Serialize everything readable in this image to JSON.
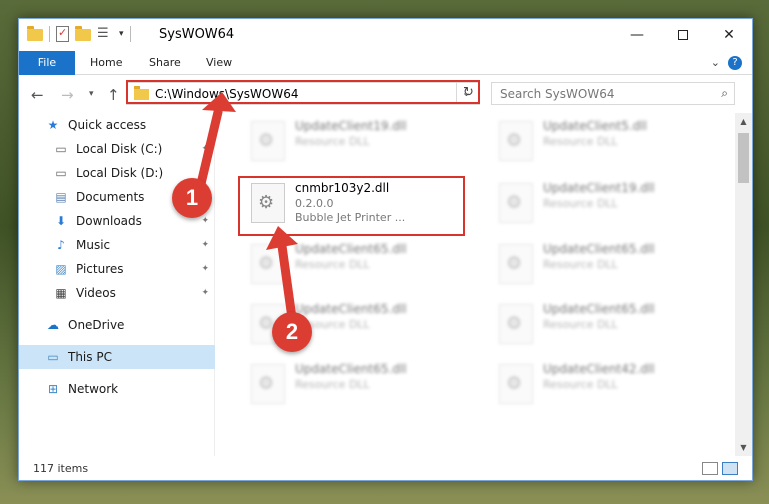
{
  "window": {
    "title": "SysWOW64"
  },
  "ribbon": {
    "tabs": [
      "File",
      "Home",
      "Share",
      "View"
    ]
  },
  "address": {
    "path": "C:\\Windows\\SysWOW64"
  },
  "search": {
    "placeholder": "Search SysWOW64"
  },
  "nav": {
    "items": [
      {
        "label": "Quick access",
        "icon": "star-icon",
        "pinned": false
      },
      {
        "label": "Local Disk (C:)",
        "icon": "drive-icon",
        "pinned": true
      },
      {
        "label": "Local Disk (D:)",
        "icon": "drive-icon",
        "pinned": true
      },
      {
        "label": "Documents",
        "icon": "documents-icon",
        "pinned": true
      },
      {
        "label": "Downloads",
        "icon": "downloads-icon",
        "pinned": true
      },
      {
        "label": "Music",
        "icon": "music-icon",
        "pinned": true
      },
      {
        "label": "Pictures",
        "icon": "pictures-icon",
        "pinned": true
      },
      {
        "label": "Videos",
        "icon": "videos-icon",
        "pinned": true
      },
      {
        "label": "OneDrive",
        "icon": "cloud-icon",
        "pinned": false
      },
      {
        "label": "This PC",
        "icon": "computer-icon",
        "pinned": false,
        "selected": true
      },
      {
        "label": "Network",
        "icon": "network-icon",
        "pinned": false
      }
    ]
  },
  "files": {
    "highlighted": {
      "name": "cnmbr103y2.dll",
      "version": "0.2.0.0",
      "description": "Bubble Jet Printer ..."
    },
    "blurred": [
      {
        "name": "UpdateClient19.dll",
        "type": "Resource DLL"
      },
      {
        "name": "UpdateClient5.dll",
        "type": "Resource DLL"
      },
      {
        "name": "UpdateClient19.dll",
        "type": "Resource DLL"
      },
      {
        "name": "UpdateClient65.dll",
        "type": "Resource DLL"
      },
      {
        "name": "UpdateClient65.dll",
        "type": "Resource DLL"
      },
      {
        "name": "UpdateClient65.dll",
        "type": "Resource DLL"
      },
      {
        "name": "UpdateClient65.dll",
        "type": "Resource DLL"
      },
      {
        "name": "UpdateClient65.dll",
        "type": "Resource DLL"
      },
      {
        "name": "UpdateClient42.dll",
        "type": "Resource DLL"
      }
    ]
  },
  "status": {
    "count": "117 items"
  },
  "callouts": {
    "one": "1",
    "two": "2"
  },
  "colors": {
    "accent": "#1a73c8",
    "highlight": "#d9342b",
    "selection": "#cce4f7"
  }
}
